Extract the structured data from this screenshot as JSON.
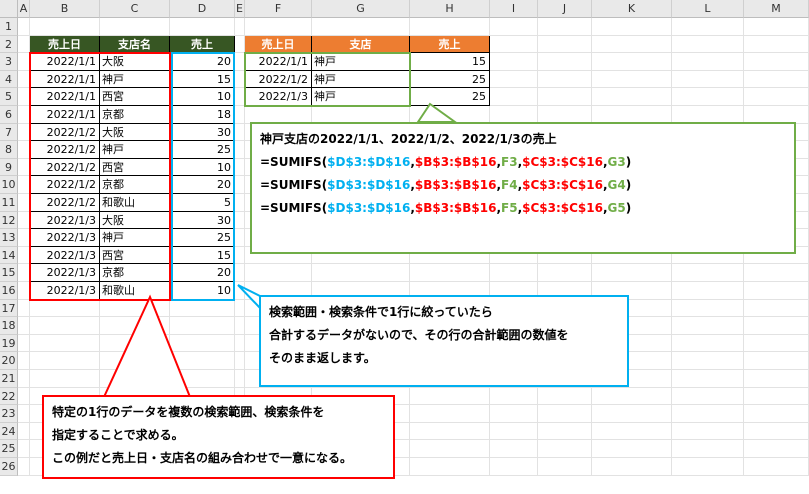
{
  "columns": [
    "A",
    "B",
    "C",
    "D",
    "E",
    "F",
    "G",
    "H",
    "I",
    "J",
    "K",
    "L",
    "M"
  ],
  "rows": [
    "1",
    "2",
    "3",
    "4",
    "5",
    "6",
    "7",
    "8",
    "9",
    "10",
    "11",
    "12",
    "13",
    "14",
    "15",
    "16",
    "17",
    "18",
    "19",
    "20",
    "21",
    "22",
    "23",
    "24",
    "25",
    "26"
  ],
  "main_table": {
    "headers": [
      "売上日",
      "支店名",
      "売上"
    ],
    "rows": [
      [
        "2022/1/1",
        "大阪",
        "20"
      ],
      [
        "2022/1/1",
        "神戸",
        "15"
      ],
      [
        "2022/1/1",
        "西宮",
        "10"
      ],
      [
        "2022/1/1",
        "京都",
        "18"
      ],
      [
        "2022/1/2",
        "大阪",
        "30"
      ],
      [
        "2022/1/2",
        "神戸",
        "25"
      ],
      [
        "2022/1/2",
        "西宮",
        "10"
      ],
      [
        "2022/1/2",
        "京都",
        "20"
      ],
      [
        "2022/1/2",
        "和歌山",
        "5"
      ],
      [
        "2022/1/3",
        "大阪",
        "30"
      ],
      [
        "2022/1/3",
        "神戸",
        "25"
      ],
      [
        "2022/1/3",
        "西宮",
        "15"
      ],
      [
        "2022/1/3",
        "京都",
        "20"
      ],
      [
        "2022/1/3",
        "和歌山",
        "10"
      ]
    ]
  },
  "result_table": {
    "headers": [
      "売上日",
      "支店",
      "売上"
    ],
    "rows": [
      [
        "2022/1/1",
        "神戸",
        "15"
      ],
      [
        "2022/1/2",
        "神戸",
        "25"
      ],
      [
        "2022/1/3",
        "神戸",
        "25"
      ]
    ]
  },
  "formula_callout": {
    "title": "神戸支店の2022/1/1、2022/1/2、2022/1/3の売上",
    "lines": [
      {
        "prefix": "=SUMIFS(",
        "sum_range": "$D$3:$D$16",
        "sep1": ",",
        "crit_range1": "$B$3:$B$16",
        "sep2": ",",
        "crit1": "F3",
        "sep3": ",",
        "crit_range2": "$C$3:$C$16",
        "sep4": ",",
        "crit2": "G3",
        "suffix": ")"
      },
      {
        "prefix": "=SUMIFS(",
        "sum_range": "$D$3:$D$16",
        "sep1": ",",
        "crit_range1": "$B$3:$B$16",
        "sep2": ",",
        "crit1": "F4",
        "sep3": ",",
        "crit_range2": "$C$3:$C$16",
        "sep4": ",",
        "crit2": "G4",
        "suffix": ")"
      },
      {
        "prefix": "=SUMIFS(",
        "sum_range": "$D$3:$D$16",
        "sep1": ",",
        "crit_range1": "$B$3:$B$16",
        "sep2": ",",
        "crit1": "F5",
        "sep3": ",",
        "crit_range2": "$C$3:$C$16",
        "sep4": ",",
        "crit2": "G5",
        "suffix": ")"
      }
    ]
  },
  "blue_callout": {
    "lines": [
      "検索範囲・検索条件で1行に絞っていたら",
      "合計するデータがないので、その行の合計範囲の数値を",
      "そのまま返します。"
    ]
  },
  "red_callout": {
    "lines": [
      "特定の1行のデータを複数の検索範囲、検索条件を",
      "指定することで求める。",
      "この例だと売上日・支店名の組み合わせで一意になる。"
    ]
  },
  "colors": {
    "green_header": "#375623",
    "orange_header": "#ed7d31",
    "blue": "#00b0f0",
    "red": "#ff0000",
    "green": "#70ad47"
  }
}
